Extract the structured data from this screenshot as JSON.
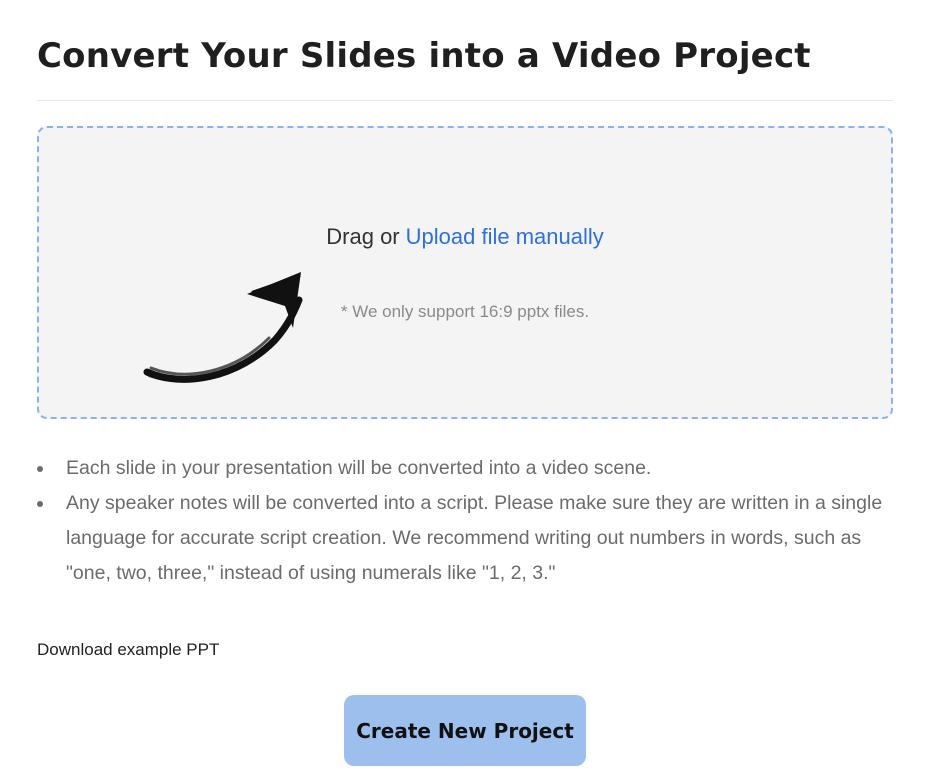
{
  "page": {
    "title": "Convert Your Slides into a Video Project"
  },
  "dropzone": {
    "lead_text": "Drag or",
    "upload_link": "Upload file manually",
    "note": "* We only support 16:9 pptx files.",
    "arrow_icon": "curved-arrow-icon"
  },
  "info": {
    "items": [
      {
        "text": "Each slide in your presentation will be converted into a video scene."
      },
      {
        "text": "Any speaker notes will be converted into a script. Please make sure they are written in a single language for accurate script creation. We recommend writing out numbers in words, such as \"one, two, three,\" instead of using numerals like \"1, 2, 3.\""
      }
    ]
  },
  "actions": {
    "download_example": "Download example PPT",
    "create_project": "Create New Project"
  },
  "colors": {
    "accent_link": "#2f6fe0",
    "dropzone_border": "#8fb1ea",
    "dropzone_bg": "#f4f4f5",
    "button_bg": "#9dbfee"
  }
}
